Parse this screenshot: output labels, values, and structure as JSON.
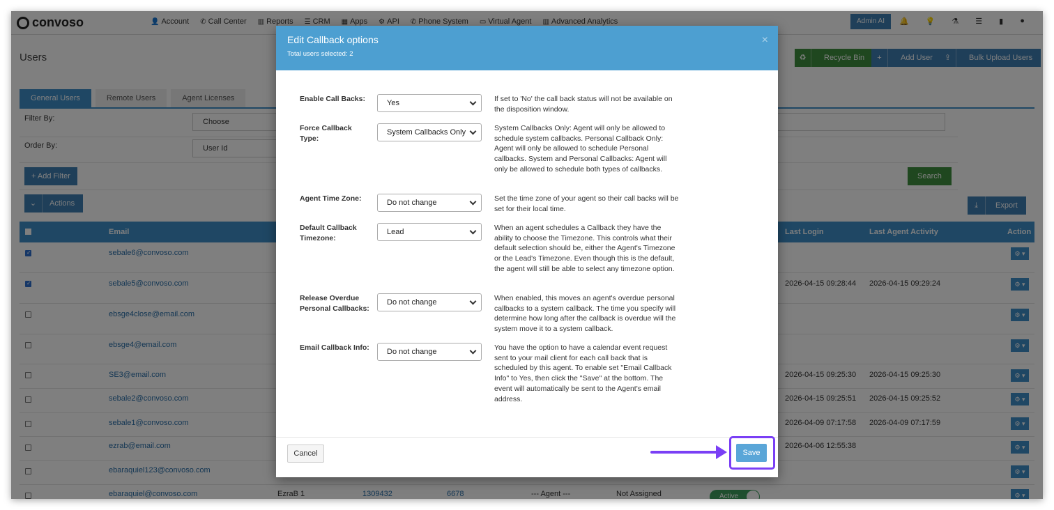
{
  "nav": {
    "logo": "convoso",
    "items": [
      {
        "icon": "user-icon",
        "glyph": "👤",
        "label": "Account"
      },
      {
        "icon": "phone-icon",
        "glyph": "✆",
        "label": "Call Center"
      },
      {
        "icon": "chart-icon",
        "glyph": "▥",
        "label": "Reports"
      },
      {
        "icon": "list-icon",
        "glyph": "☰",
        "label": "CRM"
      },
      {
        "icon": "grid-icon",
        "glyph": "▦",
        "label": "Apps"
      },
      {
        "icon": "gear-icon",
        "glyph": "⚙",
        "label": "API"
      },
      {
        "icon": "phone-icon",
        "glyph": "✆",
        "label": "Phone System"
      },
      {
        "icon": "monitor-icon",
        "glyph": "▭",
        "label": "Virtual Agent"
      },
      {
        "icon": "chart-icon",
        "glyph": "▥",
        "label": "Advanced Analytics"
      }
    ],
    "admin_ai": "Admin AI"
  },
  "page": {
    "title": "Users",
    "recycle_bin": "Recycle Bin",
    "add_user": "Add User",
    "bulk_upload": "Bulk Upload Users"
  },
  "tabs": [
    "General Users",
    "Remote Users",
    "Agent Licenses"
  ],
  "filters": {
    "filter_by_label": "Filter By:",
    "filter_by_value": "Choose",
    "order_by_label": "Order By:",
    "order_by_value": "User Id",
    "add_filter": "+ Add Filter",
    "search": "Search",
    "actions": "Actions",
    "export": "Export"
  },
  "table": {
    "headers": {
      "email": "Email",
      "last_login": "Last Login",
      "last_agent_activity": "Last Agent Activity",
      "action": "Action"
    },
    "rows": [
      {
        "checked": true,
        "email": "sebale6@convoso.com",
        "last_login": "",
        "last_activity": ""
      },
      {
        "checked": true,
        "email": "sebale5@convoso.com",
        "last_login": "2026-04-15 09:28:44",
        "last_activity": "2026-04-15 09:29:24"
      },
      {
        "checked": false,
        "email": "ebsge4close@email.com",
        "last_login": "",
        "last_activity": ""
      },
      {
        "checked": false,
        "email": "ebsge4@email.com",
        "last_login": "",
        "last_activity": ""
      },
      {
        "checked": false,
        "email": "SE3@email.com",
        "last_login": "2026-04-15 09:25:30",
        "last_activity": "2026-04-15 09:25:30"
      },
      {
        "checked": false,
        "email": "sebale2@convoso.com",
        "last_login": "2026-04-15 09:25:51",
        "last_activity": "2026-04-15 09:25:52"
      },
      {
        "checked": false,
        "email": "sebale1@convoso.com",
        "last_login": "2026-04-09 07:17:58",
        "last_activity": "2026-04-09 07:17:59"
      },
      {
        "checked": false,
        "email": "ezrab@email.com",
        "last_login": "2026-04-06 12:55:38",
        "last_activity": ""
      },
      {
        "checked": false,
        "email": "ebaraquiel123@convoso.com",
        "last_login": "",
        "last_activity": ""
      },
      {
        "checked": false,
        "email": "ebaraquiel@convoso.com",
        "last_login": "",
        "last_activity": "",
        "name": "EzraB 1",
        "user_id": "1309432",
        "ext": "6678",
        "role": "--- Agent ---",
        "assigned": "Not Assigned",
        "status": "Active"
      }
    ]
  },
  "modal": {
    "title": "Edit Callback options",
    "subtitle": "Total users selected: 2",
    "close": "×",
    "options": [
      {
        "label": "Enable Call Backs:",
        "value": "Yes",
        "help": "If set to 'No' the call back status will not be available on the disposition window."
      },
      {
        "label": "Force Callback Type:",
        "value": "System Callbacks Only",
        "help": "System Callbacks Only: Agent will only be allowed to schedule system callbacks. Personal Callback Only: Agent will only be allowed to schedule Personal callbacks. System and Personal Callbacks: Agent will only be allowed to schedule both types of callbacks."
      },
      {
        "label": "Agent Time Zone:",
        "value": "Do not change",
        "help": "Set the time zone of your agent so their call backs will be set for their local time."
      },
      {
        "label": "Default Callback Timezone:",
        "value": "Lead",
        "help": "When an agent schedules a Callback they have the ability to choose the Timezone. This controls what their default selection should be, either the Agent's Timezone or the Lead's Timezone. Even though this is the default, the agent will still be able to select any timezone option."
      },
      {
        "label": "Release Overdue Personal Callbacks:",
        "value": "Do not change",
        "help": "When enabled, this moves an agent's overdue personal callbacks to a system callback. The time you specify will determine how long after the callback is overdue will the system move it to a system callback."
      },
      {
        "label": "Email Callback Info:",
        "value": "Do not change",
        "help": "You have the option to have a calendar event request sent to your mail client for each call back that is scheduled by this agent. To enable set \"Email Callback Info\" to Yes, then click the \"Save\" at the bottom. The event will automatically be sent to the Agent's email address."
      }
    ],
    "cancel": "Cancel",
    "save": "Save",
    "highlight_color": "#7a3ff5"
  }
}
